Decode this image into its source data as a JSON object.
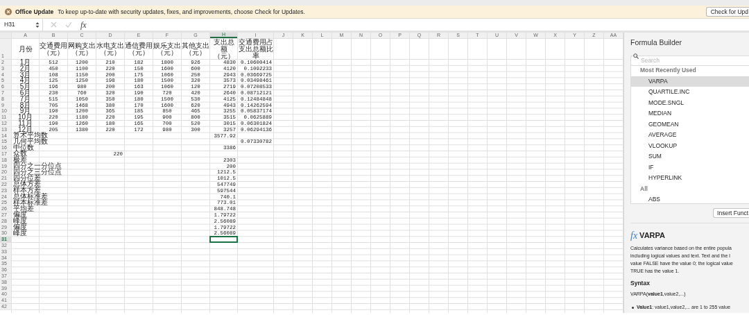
{
  "notification": {
    "title": "Office Update",
    "message": "To keep up-to-date with security updates, fixes, and improvements, choose Check for Updates.",
    "button": "Check for Upd"
  },
  "formula_bar": {
    "name_box": "H31",
    "function_label": "fx"
  },
  "columns": [
    {
      "label": "A",
      "selected": false
    },
    {
      "label": "B",
      "selected": false
    },
    {
      "label": "C",
      "selected": false
    },
    {
      "label": "D",
      "selected": false
    },
    {
      "label": "E",
      "selected": false
    },
    {
      "label": "F",
      "selected": false
    },
    {
      "label": "G",
      "selected": false
    },
    {
      "label": "H",
      "selected": true
    },
    {
      "label": "I",
      "selected": false
    },
    {
      "label": "J",
      "selected": false
    },
    {
      "label": "K",
      "selected": false
    },
    {
      "label": "L",
      "selected": false
    },
    {
      "label": "M",
      "selected": false
    },
    {
      "label": "N",
      "selected": false
    },
    {
      "label": "O",
      "selected": false
    },
    {
      "label": "P",
      "selected": false
    },
    {
      "label": "Q",
      "selected": false
    },
    {
      "label": "R",
      "selected": false
    },
    {
      "label": "S",
      "selected": false
    },
    {
      "label": "T",
      "selected": false
    },
    {
      "label": "U",
      "selected": false
    },
    {
      "label": "V",
      "selected": false
    },
    {
      "label": "W",
      "selected": false
    },
    {
      "label": "X",
      "selected": false
    },
    {
      "label": "Y",
      "selected": false
    },
    {
      "label": "Z",
      "selected": false
    },
    {
      "label": "AA",
      "selected": false
    }
  ],
  "rows": [
    {
      "number": "1",
      "selected": false,
      "cells": {
        "A": "月份",
        "B": "交通费用（元）",
        "C": "网购支出（元）",
        "D": "水电支出（元）",
        "E": "通信费用（元）",
        "F": "娱乐支出（元）",
        "G": "其他支出（元）",
        "H": "支出总额（元）",
        "I": "交通费用占支出总额比率"
      }
    },
    {
      "number": "2",
      "selected": false,
      "cells": {
        "A": "1月",
        "B": "512",
        "C": "1200",
        "D": "210",
        "E": "182",
        "F": "1800",
        "G": "926",
        "H": "4830",
        "I": "0.10600414"
      }
    },
    {
      "number": "3",
      "selected": false,
      "cells": {
        "A": "2月",
        "B": "450",
        "C": "1100",
        "D": "220",
        "E": "150",
        "F": "1600",
        "G": "600",
        "H": "4120",
        "I": "0.1092233"
      }
    },
    {
      "number": "4",
      "selected": false,
      "cells": {
        "A": "3月",
        "B": "108",
        "C": "1150",
        "D": "200",
        "E": "175",
        "F": "1060",
        "G": "250",
        "H": "2943",
        "I": "0.03669725"
      }
    },
    {
      "number": "5",
      "selected": false,
      "cells": {
        "A": "4月",
        "B": "125",
        "C": "1250",
        "D": "198",
        "E": "180",
        "F": "1500",
        "G": "320",
        "H": "3573",
        "I": "0.03498461"
      }
    },
    {
      "number": "6",
      "selected": false,
      "cells": {
        "A": "5月",
        "B": "196",
        "C": "980",
        "D": "200",
        "E": "163",
        "F": "1060",
        "G": "120",
        "H": "2719",
        "I": "0.07208533"
      }
    },
    {
      "number": "7",
      "selected": false,
      "cells": {
        "A": "6月",
        "B": "230",
        "C": "760",
        "D": "320",
        "E": "190",
        "F": "720",
        "G": "420",
        "H": "2640",
        "I": "0.08712121"
      }
    },
    {
      "number": "8",
      "selected": false,
      "cells": {
        "A": "7月",
        "B": "515",
        "C": "1050",
        "D": "350",
        "E": "180",
        "F": "1500",
        "G": "530",
        "H": "4125",
        "I": "0.12484848"
      }
    },
    {
      "number": "9",
      "selected": false,
      "cells": {
        "A": "8月",
        "B": "705",
        "C": "1468",
        "D": "380",
        "E": "170",
        "F": "1600",
        "G": "620",
        "H": "4943",
        "I": "0.14262594"
      }
    },
    {
      "number": "10",
      "selected": false,
      "cells": {
        "A": "9月",
        "B": "190",
        "C": "1200",
        "D": "365",
        "E": "185",
        "F": "850",
        "G": "465",
        "H": "3255",
        "I": "0.05837174"
      }
    },
    {
      "number": "11",
      "selected": false,
      "cells": {
        "A": "10月",
        "B": "220",
        "C": "1180",
        "D": "220",
        "E": "195",
        "F": "900",
        "G": "800",
        "H": "3515",
        "I": "0.0625889"
      }
    },
    {
      "number": "12",
      "selected": false,
      "cells": {
        "A": "11月",
        "B": "190",
        "C": "1260",
        "D": "180",
        "E": "165",
        "F": "700",
        "G": "520",
        "H": "3015",
        "I": "0.06301824"
      }
    },
    {
      "number": "13",
      "selected": false,
      "cells": {
        "A": "12月",
        "B": "205",
        "C": "1380",
        "D": "220",
        "E": "172",
        "F": "980",
        "G": "300",
        "H": "3257",
        "I": "0.06294136"
      }
    },
    {
      "number": "14",
      "selected": false,
      "cells": {
        "A": "算术平均数",
        "H": "3577.92"
      }
    },
    {
      "number": "15",
      "selected": false,
      "cells": {
        "A": "几何平均数",
        "I": "0.07330782"
      }
    },
    {
      "number": "16",
      "selected": false,
      "cells": {
        "A": "中位数",
        "H": "3386"
      }
    },
    {
      "number": "17",
      "selected": false,
      "cells": {
        "A": "众数",
        "D": "220"
      }
    },
    {
      "number": "18",
      "selected": false,
      "cells": {
        "A": "极差",
        "H": "2303"
      }
    },
    {
      "number": "19",
      "selected": false,
      "cells": {
        "A": "四分之一分位点",
        "H": "200"
      }
    },
    {
      "number": "20",
      "selected": false,
      "cells": {
        "A": "四分之三分位点",
        "H": "1212.5"
      }
    },
    {
      "number": "21",
      "selected": false,
      "cells": {
        "A": "四分位差",
        "H": "1012.5"
      }
    },
    {
      "number": "22",
      "selected": false,
      "cells": {
        "A": "总体方差",
        "H": "547749"
      }
    },
    {
      "number": "23",
      "selected": false,
      "cells": {
        "A": "样本方差",
        "H": "597544"
      }
    },
    {
      "number": "24",
      "selected": false,
      "cells": {
        "A": "总体标准差",
        "H": "740.1"
      }
    },
    {
      "number": "25",
      "selected": false,
      "cells": {
        "A": "样本标准差",
        "H": "773.01"
      }
    },
    {
      "number": "26",
      "selected": false,
      "cells": {
        "A": "平均差",
        "H": "848.748"
      }
    },
    {
      "number": "27",
      "selected": false,
      "cells": {
        "A": "偏度",
        "H": "1.79722"
      }
    },
    {
      "number": "28",
      "selected": false,
      "cells": {
        "A": "峰度",
        "H": "2.56089"
      }
    },
    {
      "number": "29",
      "selected": false,
      "cells": {
        "A": "偏度",
        "H": "1.79722"
      }
    },
    {
      "number": "30",
      "selected": false,
      "cells": {
        "A": "峰度",
        "H": "2.56089"
      }
    },
    {
      "number": "31",
      "selected": true
    },
    {
      "number": "32",
      "selected": false
    },
    {
      "number": "33",
      "selected": false
    },
    {
      "number": "34",
      "selected": false
    },
    {
      "number": "35",
      "selected": false
    },
    {
      "number": "36",
      "selected": false
    },
    {
      "number": "37",
      "selected": false
    },
    {
      "number": "38",
      "selected": false
    },
    {
      "number": "39",
      "selected": false
    },
    {
      "number": "40",
      "selected": false
    },
    {
      "number": "41",
      "selected": false
    },
    {
      "number": "42",
      "selected": false
    }
  ],
  "formula_builder": {
    "title": "Formula Builder",
    "search_placeholder": "Search",
    "items": [
      {
        "kind": "header",
        "label": "Most Recently Used"
      },
      {
        "kind": "function",
        "label": "VARPA",
        "selected": true
      },
      {
        "kind": "function",
        "label": "QUARTILE.INC",
        "selected": false
      },
      {
        "kind": "function",
        "label": "MODE.SNGL",
        "selected": false
      },
      {
        "kind": "function",
        "label": "MEDIAN",
        "selected": false
      },
      {
        "kind": "function",
        "label": "GEOMEAN",
        "selected": false
      },
      {
        "kind": "function",
        "label": "AVERAGE",
        "selected": false
      },
      {
        "kind": "function",
        "label": "VLOOKUP",
        "selected": false
      },
      {
        "kind": "function",
        "label": "SUM",
        "selected": false
      },
      {
        "kind": "function",
        "label": "IF",
        "selected": false
      },
      {
        "kind": "function",
        "label": "HYPERLINK",
        "selected": false
      },
      {
        "kind": "header",
        "label": "All"
      },
      {
        "kind": "function",
        "label": "ABS",
        "selected": false
      }
    ],
    "insert_button": "Insert Funct",
    "detail": {
      "icon": "fx",
      "name": "VARPA",
      "description_lines": [
        "Calculates variance based on the entire popula",
        "including logical values and text. Text and the l",
        "value FALSE have the value 0; the logical value",
        "TRUE has the value 1."
      ],
      "syntax_heading": "Syntax",
      "syntax": "VARPA(**value1**,value2,...)",
      "bullets": [
        "**Value1**: value1,value2,... are 1 to 255 value"
      ]
    }
  }
}
